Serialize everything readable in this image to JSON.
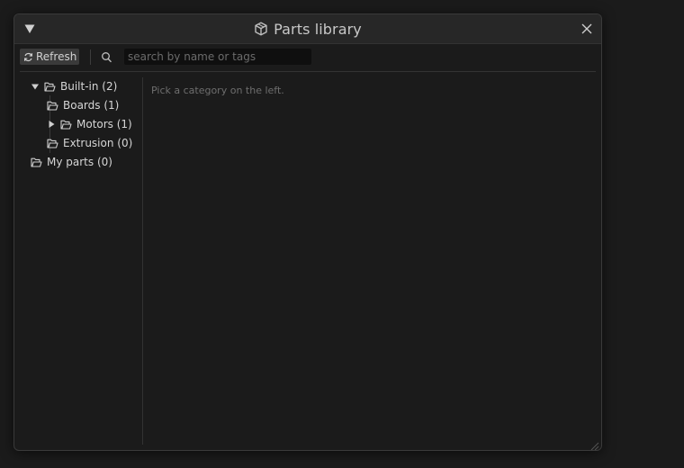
{
  "window": {
    "title": "Parts library",
    "icons": {
      "collapse": "triangle-down-icon",
      "title": "cube-icon",
      "close": "close-icon"
    }
  },
  "toolbar": {
    "refresh_label": "Refresh",
    "refresh_icon": "refresh-icon",
    "search_icon": "search-icon",
    "search_value": "",
    "search_placeholder": "search by name or tags"
  },
  "tree": {
    "items": [
      {
        "label": "Built-in (2)",
        "expanded": true,
        "icon": "folder-open-icon"
      },
      {
        "label": "Boards (1)",
        "icon": "folder-open-icon"
      },
      {
        "label": "Motors (1)",
        "expanded": false,
        "icon": "folder-open-icon"
      },
      {
        "label": "Extrusion (0)",
        "icon": "folder-open-icon"
      },
      {
        "label": "My parts (0)",
        "icon": "folder-open-icon"
      }
    ]
  },
  "main": {
    "hint": "Pick a category on the left."
  },
  "colors": {
    "background": "#1b1b1b",
    "titlebar": "#272727",
    "button": "#3a3a3a",
    "input": "#0f0f0f",
    "text": "#d6d6d6",
    "hint": "#6e6e6e"
  }
}
